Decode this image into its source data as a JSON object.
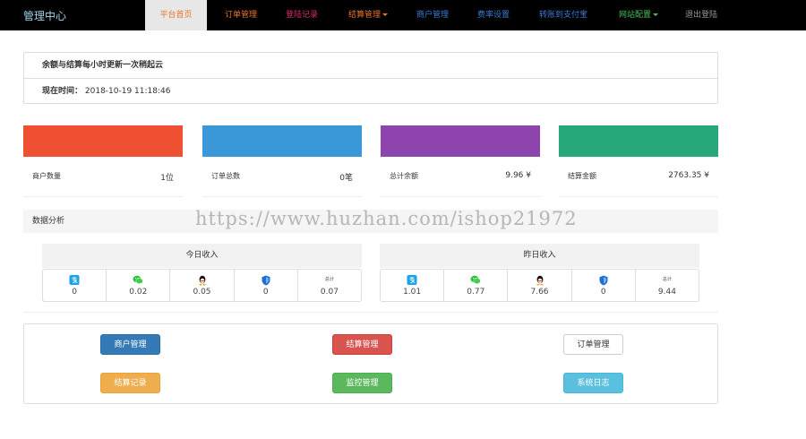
{
  "nav": {
    "brand": "管理中心",
    "items": [
      {
        "label": "平台首页",
        "color": "#e8742a",
        "active": true,
        "dropdown": false
      },
      {
        "label": "订单管理",
        "color": "#e8742a",
        "dropdown": false
      },
      {
        "label": "登陆记录",
        "color": "#d9306a",
        "dropdown": false
      },
      {
        "label": "结算管理",
        "color": "#e8742a",
        "dropdown": true
      },
      {
        "label": "商户管理",
        "color": "#3a7bd5",
        "dropdown": false
      },
      {
        "label": "费率设置",
        "color": "#3a7bd5",
        "dropdown": false
      },
      {
        "label": "转账到支付宝",
        "color": "#3a7bd5",
        "dropdown": false
      },
      {
        "label": "网站配置",
        "color": "#4bc05a",
        "dropdown": true
      },
      {
        "label": "退出登陆",
        "color": "#999999",
        "dropdown": false
      }
    ]
  },
  "info": {
    "notice": "余额与结算每小时更新一次稍起云",
    "time_label": "现在时间：",
    "time_value": "2018-10-19 11:18:46"
  },
  "stats": [
    {
      "label": "商户数量",
      "value": "1位",
      "color": "#f05032"
    },
    {
      "label": "订单总数",
      "value": "0笔",
      "color": "#3a98d8"
    },
    {
      "label": "总计余额",
      "value": "9.96 ¥",
      "color": "#8e44ad"
    },
    {
      "label": "结算金额",
      "value": "2763.35 ¥",
      "color": "#27a878"
    }
  ],
  "analysis": {
    "title": "数据分析",
    "today": {
      "title": "今日收入",
      "cells": [
        {
          "icon": "alipay-icon",
          "value": "0"
        },
        {
          "icon": "wechat-icon",
          "value": "0.02"
        },
        {
          "icon": "qq-icon",
          "value": "0.05"
        },
        {
          "icon": "tenpay-icon",
          "value": "0"
        },
        {
          "icon": "total",
          "text": "总计",
          "value": "0.07"
        }
      ]
    },
    "yesterday": {
      "title": "昨日收入",
      "cells": [
        {
          "icon": "alipay-icon",
          "value": "1.01"
        },
        {
          "icon": "wechat-icon",
          "value": "0.77"
        },
        {
          "icon": "qq-icon",
          "value": "7.66"
        },
        {
          "icon": "tenpay-icon",
          "value": "0"
        },
        {
          "icon": "total",
          "text": "总计",
          "value": "9.44"
        }
      ]
    }
  },
  "quick": [
    {
      "label": "商户管理",
      "bg": "#337ab7",
      "fg": "#ffffff",
      "border": "#2e6da4"
    },
    {
      "label": "结算管理",
      "bg": "#d9534f",
      "fg": "#ffffff",
      "border": "#d43f3a"
    },
    {
      "label": "订单管理",
      "bg": "#ffffff",
      "fg": "#333333",
      "border": "#cccccc"
    },
    {
      "label": "结算记录",
      "bg": "#f0ad4e",
      "fg": "#ffffff",
      "border": "#eea236"
    },
    {
      "label": "监控管理",
      "bg": "#5cb85c",
      "fg": "#ffffff",
      "border": "#4cae4c"
    },
    {
      "label": "系统日志",
      "bg": "#5bc0de",
      "fg": "#ffffff",
      "border": "#46b8da"
    }
  ],
  "watermark": "https://www.huzhan.com/ishop21972"
}
